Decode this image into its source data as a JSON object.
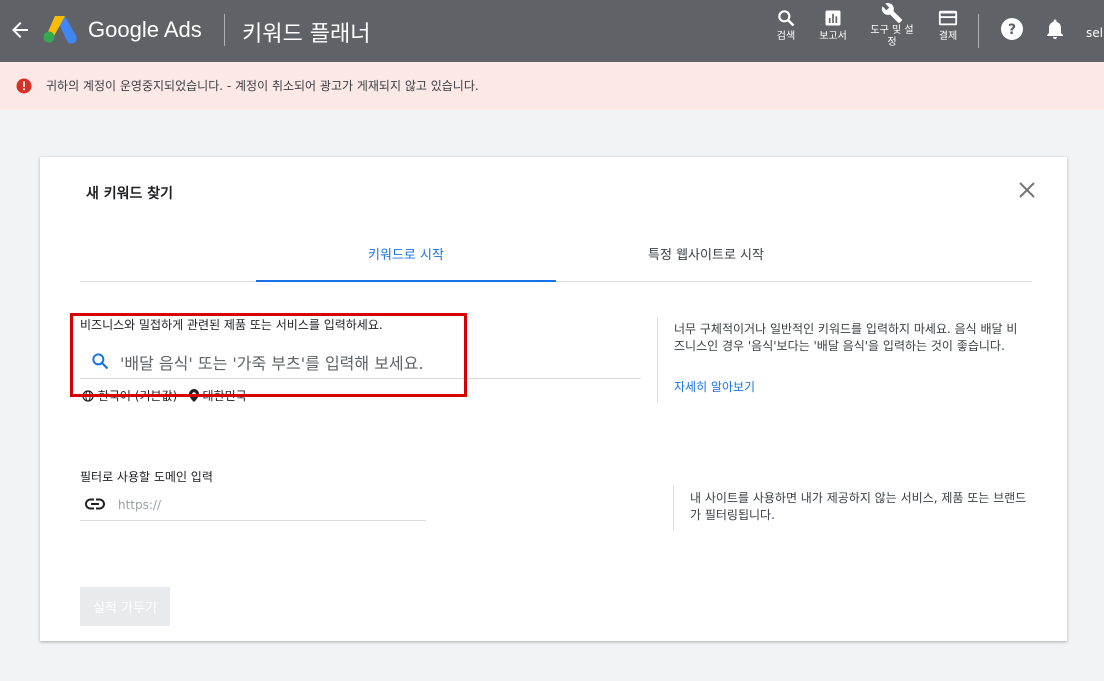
{
  "header": {
    "brand": "Google Ads",
    "page_title": "키워드 플래너",
    "tools": [
      {
        "icon": "search-icon",
        "label": "검색"
      },
      {
        "icon": "reports-icon",
        "label": "보고서"
      },
      {
        "icon": "wrench-icon",
        "label": "도구 및 설정"
      },
      {
        "icon": "billing-icon",
        "label": "결제"
      }
    ],
    "user": "sell"
  },
  "alert": {
    "icon": "error-icon",
    "text": "귀하의 계정이 운영중지되었습니다. - 계정이 취소되어 광고가 게재되지 않고 있습니다."
  },
  "dialog": {
    "title": "새 키워드 찾기",
    "tabs": [
      {
        "label": "키워드로 시작",
        "active": true
      },
      {
        "label": "특정 웹사이트로 시작",
        "active": false
      }
    ],
    "keyword_section": {
      "prompt": "비즈니스와 밀접하게 관련된 제품 또는 서비스를 입력하세요.",
      "placeholder": "'배달 음식' 또는 '가죽 부츠'를 입력해 보세요.",
      "language": "한국어 (기본값)",
      "location": "대한민국"
    },
    "keyword_hint": {
      "text": "너무 구체적이거나 일반적인 키워드를 입력하지 마세요. 음식 배달 비즈니스인 경우 '음식'보다는 '배달 음식'을 입력하는 것이 좋습니다.",
      "learn_more": "자세히 알아보기"
    },
    "domain_section": {
      "label": "필터로 사용할 도메인 입력",
      "placeholder": "https://"
    },
    "domain_hint": "내 사이트를 사용하면 내가 제공하지 않는 서비스, 제품 또는 브랜드가 필터링됩니다.",
    "submit_label": "실적 가두기"
  },
  "colors": {
    "topbar": "#5f6368",
    "accent": "#1a73e8",
    "alert_bg": "#fce8e6",
    "alert_icon": "#d93025",
    "highlight_box": "#d50000"
  }
}
